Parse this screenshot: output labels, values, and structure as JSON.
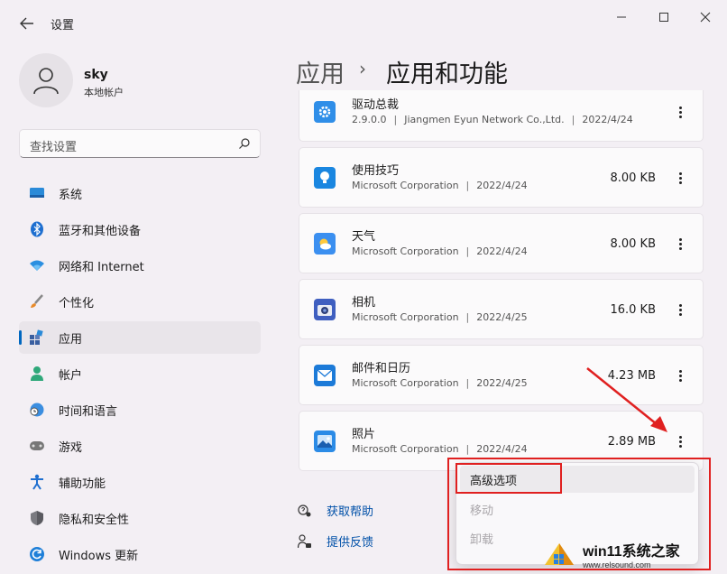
{
  "window": {
    "title": "设置",
    "controls": [
      "minimize-icon",
      "maximize-icon",
      "close-icon"
    ]
  },
  "profile": {
    "name": "sky",
    "account_type": "本地帐户"
  },
  "search": {
    "placeholder": "查找设置"
  },
  "sidebar": {
    "items": [
      {
        "label": "系统",
        "icon": "system-icon"
      },
      {
        "label": "蓝牙和其他设备",
        "icon": "bluetooth-icon"
      },
      {
        "label": "网络和 Internet",
        "icon": "wifi-icon"
      },
      {
        "label": "个性化",
        "icon": "brush-icon"
      },
      {
        "label": "应用",
        "icon": "apps-icon",
        "active": true
      },
      {
        "label": "帐户",
        "icon": "account-icon"
      },
      {
        "label": "时间和语言",
        "icon": "clock-globe-icon"
      },
      {
        "label": "游戏",
        "icon": "gamepad-icon"
      },
      {
        "label": "辅助功能",
        "icon": "accessibility-icon"
      },
      {
        "label": "隐私和安全性",
        "icon": "shield-icon"
      },
      {
        "label": "Windows 更新",
        "icon": "update-icon"
      }
    ]
  },
  "breadcrumb": {
    "parent": "应用",
    "separator": "›",
    "current": "应用和功能"
  },
  "apps": [
    {
      "name": "驱动总裁",
      "meta": [
        "2.9.0.0",
        "Jiangmen Eyun Network Co.,Ltd.",
        "2022/4/24"
      ],
      "size": "",
      "icon": "driver-gear-icon",
      "color": "#2f8ee8"
    },
    {
      "name": "使用技巧",
      "meta": [
        "Microsoft Corporation",
        "2022/4/24"
      ],
      "size": "8.00 KB",
      "icon": "lightbulb-icon",
      "color": "#1a86e0"
    },
    {
      "name": "天气",
      "meta": [
        "Microsoft Corporation",
        "2022/4/24"
      ],
      "size": "8.00 KB",
      "icon": "weather-icon",
      "color": "#3b8ff0"
    },
    {
      "name": "相机",
      "meta": [
        "Microsoft Corporation",
        "2022/4/25"
      ],
      "size": "16.0 KB",
      "icon": "camera-icon",
      "color": "#3f5fc0"
    },
    {
      "name": "邮件和日历",
      "meta": [
        "Microsoft Corporation",
        "2022/4/25"
      ],
      "size": "4.23 MB",
      "icon": "mail-icon",
      "color": "#1c7ad8"
    },
    {
      "name": "照片",
      "meta": [
        "Microsoft Corporation",
        "2022/4/24"
      ],
      "size": "2.89 MB",
      "icon": "photos-icon",
      "color": "#2b8be6"
    }
  ],
  "context_menu": {
    "items": [
      {
        "label": "高级选项",
        "enabled": true
      },
      {
        "label": "移动",
        "enabled": false
      },
      {
        "label": "卸载",
        "enabled": false
      }
    ]
  },
  "footer_links": [
    {
      "label": "获取帮助",
      "icon": "help-icon"
    },
    {
      "label": "提供反馈",
      "icon": "feedback-icon"
    }
  ],
  "watermark": {
    "title": "win11系统之家",
    "url": "www.relsound.com"
  },
  "colors": {
    "accent": "#0067c0",
    "annotation": "#e02020",
    "background": "#f3eff4",
    "card": "#fbfafb"
  }
}
